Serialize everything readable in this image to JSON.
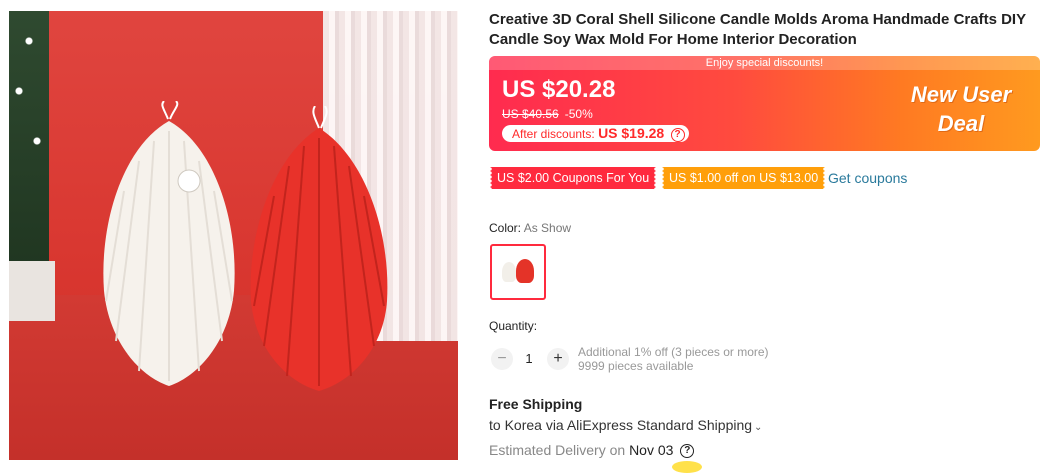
{
  "product": {
    "title": "Creative 3D Coral Shell Silicone Candle Molds Aroma Handmade Crafts DIY Candle Soy Wax Mold For Home Interior Decoration",
    "image_icon": "product-photo"
  },
  "deal": {
    "banner_text": "Enjoy special discounts!",
    "price": "US $20.28",
    "original_price": "US $40.56",
    "discount_pct": "-50%",
    "after_label": "After discounts:",
    "after_price": "US $19.28",
    "help_icon": "?",
    "badge_line1": "New User",
    "badge_line2": "Deal"
  },
  "coupons": [
    {
      "label": "US $2.00 Coupons For You",
      "color": "#ff2a3e"
    },
    {
      "label": "US $1.00 off on US $13.00",
      "color": "#ff9f0a"
    }
  ],
  "get_coupons": "Get coupons",
  "color": {
    "label": "Color:",
    "value": "As Show"
  },
  "quantity": {
    "label": "Quantity:",
    "minus": "−",
    "value": "1",
    "plus": "+",
    "note_line1": "Additional 1% off (3 pieces or more)",
    "note_line2": "9999 pieces available"
  },
  "shipping": {
    "title": "Free Shipping",
    "route": "to Korea via AliExpress Standard Shipping",
    "chevron": "⌄",
    "est_label": "Estimated Delivery on",
    "est_date": "Nov 03",
    "help_icon": "?"
  },
  "colors": {
    "accent_red": "#ff2a3e",
    "accent_orange": "#ff9f0a",
    "link": "#2a7a9c"
  }
}
